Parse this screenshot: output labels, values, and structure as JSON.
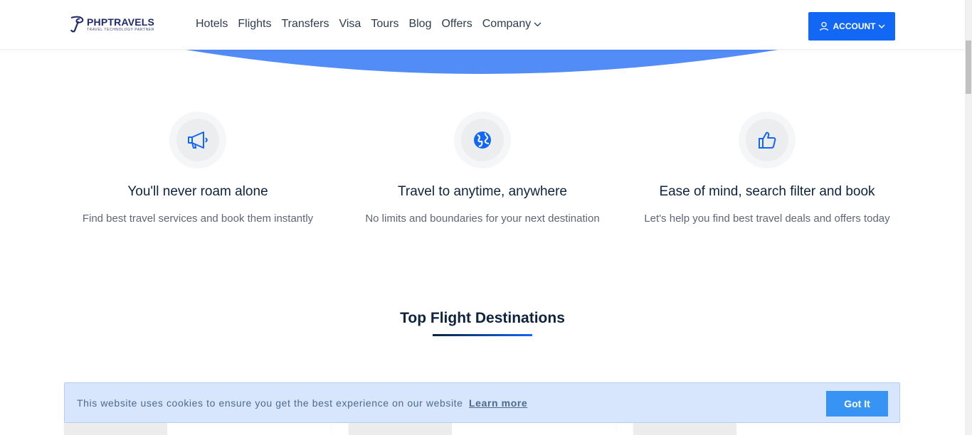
{
  "header": {
    "logo": {
      "name": "PHPTRAVELS",
      "tagline": "TRAVEL TECHNOLOGY PARTNER"
    },
    "nav": [
      {
        "label": "Hotels"
      },
      {
        "label": "Flights"
      },
      {
        "label": "Transfers"
      },
      {
        "label": "Visa"
      },
      {
        "label": "Tours"
      },
      {
        "label": "Blog"
      },
      {
        "label": "Offers"
      },
      {
        "label": "Company",
        "dropdown": true
      }
    ],
    "account_label": "ACCOUNT"
  },
  "features": [
    {
      "icon": "megaphone-icon",
      "title": "You'll never roam alone",
      "text": "Find best travel services and book them instantly"
    },
    {
      "icon": "globe-icon",
      "title": "Travel to anytime, anywhere",
      "text": "No limits and boundaries for your next destination"
    },
    {
      "icon": "thumbs-up-icon",
      "title": "Ease of mind, search filter and book",
      "text": "Let's help you find best travel deals and offers today"
    }
  ],
  "section": {
    "title": "Top Flight Destinations"
  },
  "cookie": {
    "text": "This website uses cookies to ensure you get the best experience on our website",
    "link": "Learn more",
    "button": "Got It"
  },
  "colors": {
    "accent": "#1268f5",
    "hero": "#528cf7",
    "cookie_bg": "#d7e6fd",
    "cookie_button": "#3794f4"
  }
}
